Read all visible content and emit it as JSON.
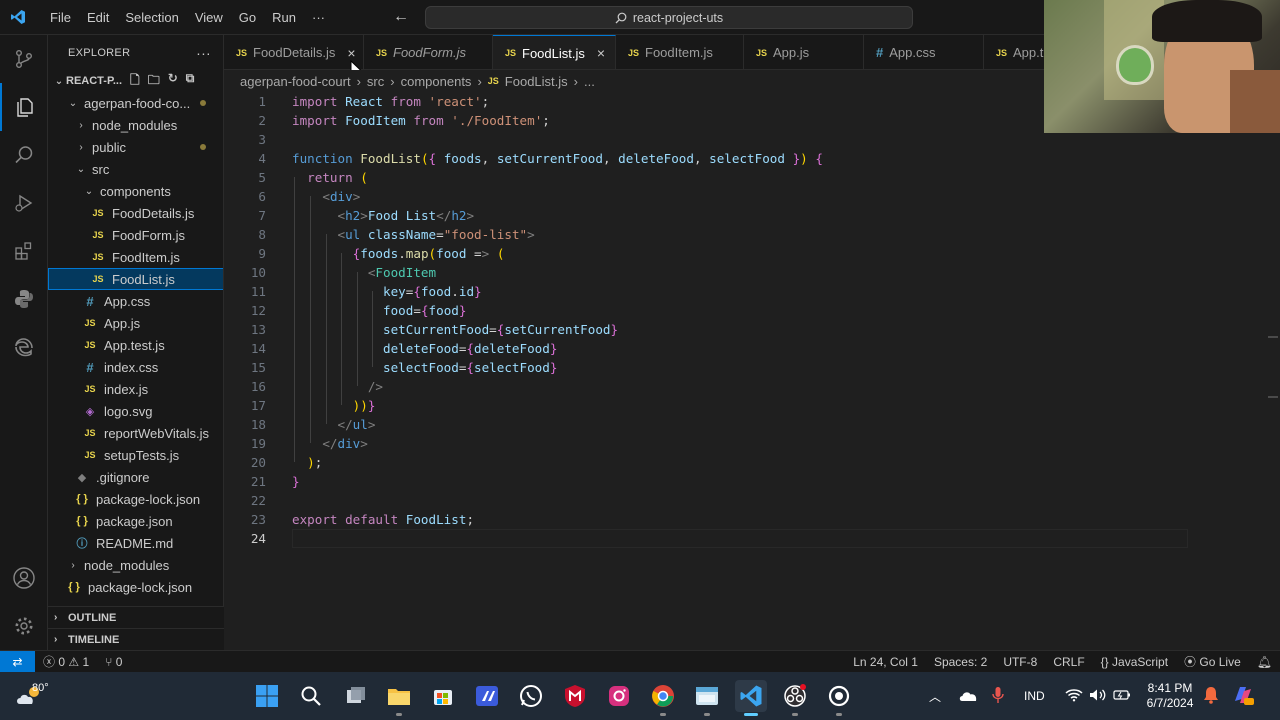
{
  "titlebar": {
    "menu": [
      "File",
      "Edit",
      "Selection",
      "View",
      "Go",
      "Run",
      "···"
    ],
    "search": "react-project-uts"
  },
  "activity": [
    "files-icon",
    "source-control-icon",
    "explorer-icon",
    "search-icon",
    "run-debug-icon",
    "extensions-icon",
    "python-icon",
    "edge-icon",
    "account-icon",
    "settings-icon"
  ],
  "sidebar": {
    "title": "EXPLORER",
    "more": "···",
    "root": "REACT-P...",
    "items": [
      {
        "label": "agerpan-food-co...",
        "depth": 1,
        "type": "folder-open",
        "dot": true
      },
      {
        "label": "node_modules",
        "depth": 2,
        "type": "folder"
      },
      {
        "label": "public",
        "depth": 2,
        "type": "folder",
        "dot": true
      },
      {
        "label": "src",
        "depth": 2,
        "type": "folder-open"
      },
      {
        "label": "components",
        "depth": 3,
        "type": "folder-open"
      },
      {
        "label": "FoodDetails.js",
        "depth": 4,
        "type": "js"
      },
      {
        "label": "FoodForm.js",
        "depth": 4,
        "type": "js"
      },
      {
        "label": "FoodItem.js",
        "depth": 4,
        "type": "js"
      },
      {
        "label": "FoodList.js",
        "depth": 4,
        "type": "js",
        "selected": true
      },
      {
        "label": "App.css",
        "depth": 3,
        "type": "css"
      },
      {
        "label": "App.js",
        "depth": 3,
        "type": "js"
      },
      {
        "label": "App.test.js",
        "depth": 3,
        "type": "js"
      },
      {
        "label": "index.css",
        "depth": 3,
        "type": "css"
      },
      {
        "label": "index.js",
        "depth": 3,
        "type": "js"
      },
      {
        "label": "logo.svg",
        "depth": 3,
        "type": "svg"
      },
      {
        "label": "reportWebVitals.js",
        "depth": 3,
        "type": "js"
      },
      {
        "label": "setupTests.js",
        "depth": 3,
        "type": "js"
      },
      {
        "label": ".gitignore",
        "depth": 2,
        "type": "git"
      },
      {
        "label": "package-lock.json",
        "depth": 2,
        "type": "json"
      },
      {
        "label": "package.json",
        "depth": 2,
        "type": "json"
      },
      {
        "label": "README.md",
        "depth": 2,
        "type": "md"
      },
      {
        "label": "node_modules",
        "depth": 1,
        "type": "folder"
      },
      {
        "label": "package-lock.json",
        "depth": 1,
        "type": "json"
      }
    ],
    "outline": "OUTLINE",
    "timeline": "TIMELINE"
  },
  "tabs": [
    {
      "label": "FoodDetails.js",
      "icon": "JS",
      "close": "×"
    },
    {
      "label": "FoodForm.js",
      "icon": "JS",
      "italic": true
    },
    {
      "label": "FoodList.js",
      "icon": "JS",
      "active": true,
      "close": "×"
    },
    {
      "label": "FoodItem.js",
      "icon": "JS"
    },
    {
      "label": "App.js",
      "icon": "JS"
    },
    {
      "label": "App.css",
      "icon": "#"
    },
    {
      "label": "App.t",
      "icon": "JS"
    }
  ],
  "breadcrumb": [
    "agerpan-food-court",
    "src",
    "components",
    "FoodList.js",
    "..."
  ],
  "editor": {
    "current_line": 24,
    "lines": [
      "import React from 'react';",
      "import FoodItem from './FoodItem';",
      "",
      "function FoodList({ foods, setCurrentFood, deleteFood, selectFood }) {",
      "  return (",
      "    <div>",
      "      <h2>Food List</h2>",
      "      <ul className=\"food-list\">",
      "        {foods.map(food => (",
      "          <FoodItem",
      "            key={food.id}",
      "            food={food}",
      "            setCurrentFood={setCurrentFood}",
      "            deleteFood={deleteFood}",
      "            selectFood={selectFood}",
      "          />",
      "        ))}",
      "      </ul>",
      "    </div>",
      "  );",
      "}",
      "",
      "export default FoodList;",
      ""
    ]
  },
  "statusbar": {
    "errors": "0",
    "warnings": "1",
    "ports": "0",
    "position": "Ln 24, Col 1",
    "spaces": "Spaces: 2",
    "encoding": "UTF-8",
    "eol": "CRLF",
    "language": "JavaScript",
    "golive": "Go Live"
  },
  "taskbar": {
    "weather": "80°",
    "lang": "IND",
    "time": "8:41 PM",
    "date": "6/7/2024"
  }
}
